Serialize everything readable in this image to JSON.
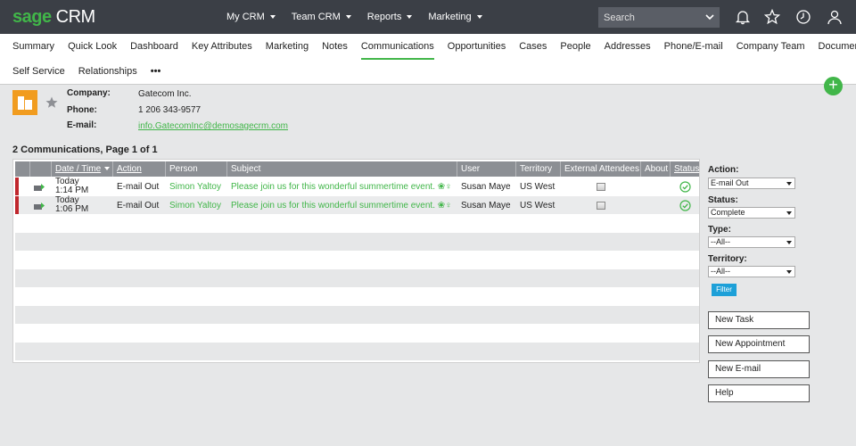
{
  "app": {
    "logo_brand": "sage",
    "logo_product": "CRM"
  },
  "topnav": [
    {
      "label": "My CRM"
    },
    {
      "label": "Team CRM"
    },
    {
      "label": "Reports"
    },
    {
      "label": "Marketing"
    }
  ],
  "search": {
    "placeholder": "Search"
  },
  "top_icons": [
    "bell-icon",
    "star-icon",
    "clock-icon",
    "user-icon"
  ],
  "tabs_row1": [
    "Summary",
    "Quick Look",
    "Dashboard",
    "Key Attributes",
    "Marketing",
    "Notes",
    "Communications",
    "Opportunities",
    "Cases",
    "People",
    "Addresses",
    "Phone/E-mail",
    "Company Team",
    "Documents"
  ],
  "tabs_row2": [
    "Self Service",
    "Relationships",
    "•••"
  ],
  "active_tab": "Communications",
  "company": {
    "company_label": "Company:",
    "company_value": "Gatecom Inc.",
    "phone_label": "Phone:",
    "phone_value": "1 206 343-9577",
    "email_label": "E-mail:",
    "email_value": "info.GatecomInc@demosagecrm.com"
  },
  "list": {
    "title": "2 Communications, Page 1 of 1",
    "columns": [
      "Date / Time",
      "Action",
      "Person",
      "Subject",
      "User",
      "Territory",
      "External Attendees",
      "About",
      "Status"
    ],
    "rows": [
      {
        "date": "Today",
        "time": "1:14 PM",
        "action": "E-mail Out",
        "person": "Simon Yaltoy",
        "subject": "Please join us for this wonderful summertime event. ❀♀",
        "user": "Susan Maye",
        "territory": "US West"
      },
      {
        "date": "Today",
        "time": "1:06 PM",
        "action": "E-mail Out",
        "person": "Simon Yaltoy",
        "subject": "Please join us for this wonderful summertime event. ❀♀",
        "user": "Susan Maye",
        "territory": "US West"
      }
    ]
  },
  "filter": {
    "action_label": "Action:",
    "action_value": "E-mail Out",
    "status_label": "Status:",
    "status_value": "Complete",
    "type_label": "Type:",
    "type_value": "--All--",
    "territory_label": "Territory:",
    "territory_value": "--All--",
    "filter_button": "Filter"
  },
  "actions": {
    "new_task": "New Task",
    "new_appointment": "New Appointment",
    "new_email": "New E-mail",
    "help": "Help"
  },
  "colors": {
    "accent": "#41b649",
    "topbar": "#3b3f46",
    "company_icon": "#f19c1f",
    "row_marker": "#c0272d",
    "filter_button": "#1da0d8"
  }
}
